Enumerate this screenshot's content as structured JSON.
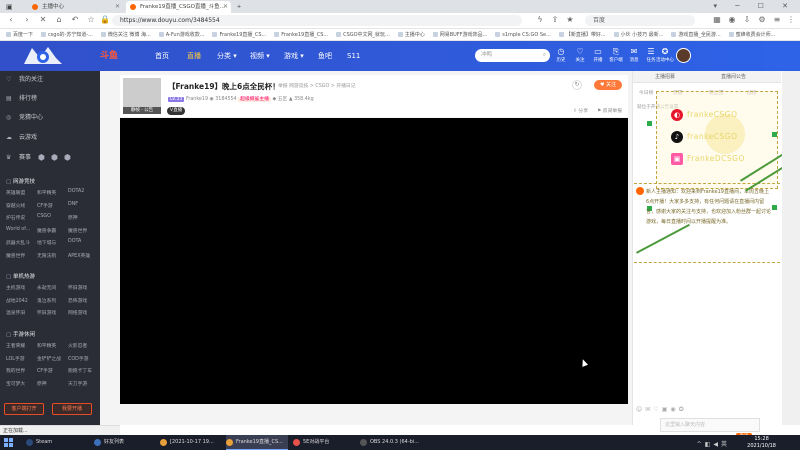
{
  "browser": {
    "tabs": [
      {
        "label": "主播中心",
        "active": false
      },
      {
        "label": "Franke19直播_CSGO直播_斗鱼...",
        "active": true
      }
    ],
    "url": "https://www.douyu.com/3484554",
    "search_placeholder": "百度",
    "bookmarks": [
      "百度一下",
      "csgo的-苏宁知道-...",
      "微信关注 微博 海...",
      "A-Fun游戏收款...",
      "Franke19直播_CS...",
      "Franke19直播_CS...",
      "CSGO中文网_就玩...",
      "主播中心",
      "网易BUFF游戏饰品...",
      "s1mple CS:GO Se...",
      "【新直播】带好...",
      "小伙 小技巧 最新...",
      "游戏直播_全民游...",
      "蜜蜂收费会计师..."
    ]
  },
  "site": {
    "logo_text": "斗鱼",
    "nav": [
      {
        "label": "首页",
        "active": false
      },
      {
        "label": "直播",
        "active": true
      },
      {
        "label": "分类",
        "active": false,
        "arrow": true
      },
      {
        "label": "视频",
        "active": false,
        "arrow": true
      },
      {
        "label": "游戏",
        "active": false,
        "arrow": true
      },
      {
        "label": "鱼吧",
        "active": false
      },
      {
        "label": "S11",
        "active": false
      }
    ],
    "search_placeholder": "冲鸭",
    "icons": [
      {
        "icon": "history-icon",
        "label": "历史"
      },
      {
        "icon": "follow-icon",
        "label": "关注"
      },
      {
        "icon": "broadcast-icon",
        "label": "开播"
      },
      {
        "icon": "client-icon",
        "label": "客户端"
      },
      {
        "icon": "mail-icon",
        "label": "消息"
      },
      {
        "icon": "task-icon",
        "label": "任务"
      },
      {
        "icon": "badge-icon",
        "label": "活动中心"
      }
    ]
  },
  "sidebar": {
    "main": [
      {
        "icon": "heart-icon",
        "label": "我的关注"
      },
      {
        "icon": "rank-icon",
        "label": "排行榜"
      },
      {
        "icon": "reward-icon",
        "label": "竞猜中心"
      },
      {
        "icon": "cloud-game-icon",
        "label": "云游戏"
      },
      {
        "icon": "match-icon",
        "label": "赛事"
      }
    ],
    "sections": [
      {
        "title": "网游竞技",
        "items": [
          "英雄联盟",
          "和平精英",
          "DOTA2",
          "穿越火线",
          "CF手游",
          "DNF",
          "炉石传说",
          "CSGO",
          "原神",
          "World of...",
          "魔兽争霸",
          "魔兽世界",
          "武器大乱斗",
          "地下城与",
          "DOTA",
          "魔兽世界",
          "无限法则",
          "APEX英雄"
        ]
      },
      {
        "title": "单机热游",
        "items": [
          "主机游戏",
          "永劫无间",
          "怀旧游戏",
          "战地2042",
          "鬼泣系列",
          "恐怖游戏",
          "温泉怀旧",
          "怀旧游戏",
          "网络游戏"
        ]
      },
      {
        "title": "手游休闲",
        "items": [
          "王者荣耀",
          "和平精英",
          "火影忍者",
          "LOL手游",
          "金铲铲之战",
          "COD手游",
          "我的世界",
          "CF手游",
          "跑跑卡丁车",
          "宝可梦大",
          "原神",
          "天刀手游"
        ]
      }
    ],
    "btn_client": "客户端打开",
    "btn_broadcast": "我要开播"
  },
  "room": {
    "title": "【Franke19】晚上6点全民杯！",
    "category": "举报  网游竞技 > CSGO > 开播日记",
    "level": "LV.33",
    "streamer": "Franke19",
    "room_id": "3184554",
    "badge": "超级鲸鲨主播",
    "rank": "五区",
    "popularity": "358.4kg",
    "vtag": "V直播",
    "avatar_tag": "静帧 · 公告",
    "follow": "关注",
    "share": "分享",
    "report": "房间举报"
  },
  "right_panel": {
    "tabs": [
      "主播招募",
      "直播间公告"
    ],
    "subtabs": [
      "今日榜",
      "贵族",
      "粉丝团",
      "战绩"
    ],
    "rank_tip": "就位于开播公告设置",
    "social": [
      {
        "icon": "weibo-icon",
        "text": "frankeCSGO",
        "color": "#e6162d"
      },
      {
        "icon": "tiktok-icon",
        "text": "frankeCSGO",
        "color": "#111111"
      },
      {
        "icon": "bilibili-icon",
        "text": "FrankeDCSGO",
        "color": "#ff5ba5"
      }
    ],
    "notice": "新人主播通知：欢迎来到Franke19直播间，本周五晚上6点开播！大家多多支持，有任何问题请在直播间内留言，感谢大家的关注与支持，也欢迎加入粉丝群一起讨论游戏，每日直播时间以开播提醒为准。",
    "chat_placeholder": "这里输入聊天内容",
    "send": "发送"
  },
  "status_bar": "正在加载...",
  "taskbar": {
    "items": [
      {
        "label": "Steam",
        "active": false,
        "color": "#2a4a7a"
      },
      {
        "label": "好友列表",
        "active": false,
        "color": "#3c70b8"
      },
      {
        "label": "[2021-10-17 19...",
        "active": false,
        "color": "#e8a03a"
      },
      {
        "label": "Franke19直播_CS...",
        "active": true,
        "color": "#e8a03a"
      },
      {
        "label": "5E对战平台",
        "active": false,
        "color": "#e8524a"
      },
      {
        "label": "OBS 24.0.3 (64-bi...",
        "active": false,
        "color": "#333333"
      }
    ],
    "time": "15:28",
    "date": "2021/10/18"
  }
}
